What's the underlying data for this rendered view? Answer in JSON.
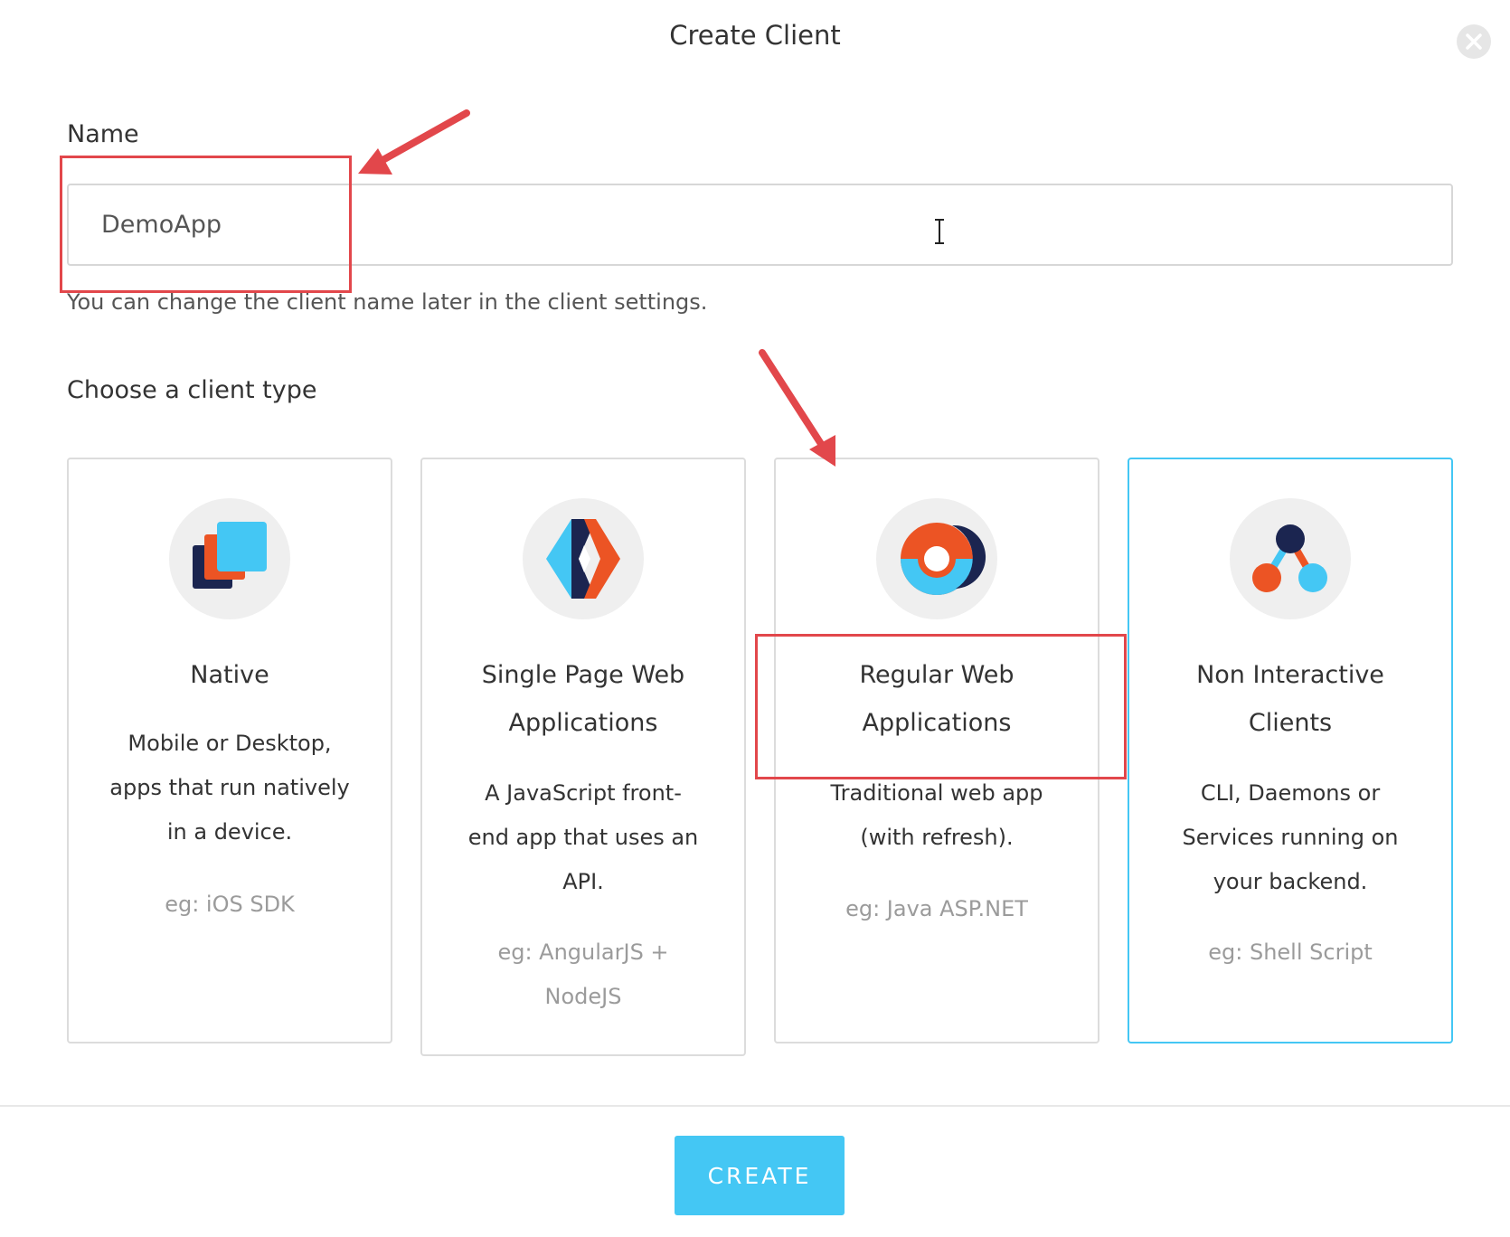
{
  "dialog": {
    "title": "Create Client",
    "close_icon": "close-icon"
  },
  "name_field": {
    "label": "Name",
    "value": "DemoApp",
    "hint": "You can change the client name later in the client settings."
  },
  "client_type": {
    "label": "Choose a client type",
    "cards": [
      {
        "icon": "native-stack-icon",
        "title_lines": [
          "Native"
        ],
        "desc_lines": [
          "Mobile or Desktop,",
          "apps that run natively",
          "in a device."
        ],
        "example_lines": [
          "eg: iOS SDK"
        ],
        "selected": false
      },
      {
        "icon": "spa-diamond-icon",
        "title_lines": [
          "Single Page Web",
          "Applications"
        ],
        "desc_lines": [
          "A JavaScript front-",
          "end app that uses an",
          "API."
        ],
        "example_lines": [
          "eg: AngularJS +",
          "NodeJS"
        ],
        "selected": false
      },
      {
        "icon": "regular-web-ring-icon",
        "title_lines": [
          "Regular Web",
          "Applications"
        ],
        "desc_lines": [
          "Traditional web app",
          "(with refresh)."
        ],
        "example_lines": [
          "eg: Java ASP.NET"
        ],
        "selected": false
      },
      {
        "icon": "non-interactive-nodes-icon",
        "title_lines": [
          "Non Interactive",
          "Clients"
        ],
        "desc_lines": [
          "CLI, Daemons or",
          "Services running on",
          "your backend."
        ],
        "example_lines": [
          "eg: Shell Script"
        ],
        "selected": true
      }
    ]
  },
  "footer": {
    "create_label": "CREATE"
  },
  "colors": {
    "accent": "#44c7f4",
    "navy": "#1b2550",
    "orange": "#ec5424",
    "annotation": "#e2474b"
  }
}
